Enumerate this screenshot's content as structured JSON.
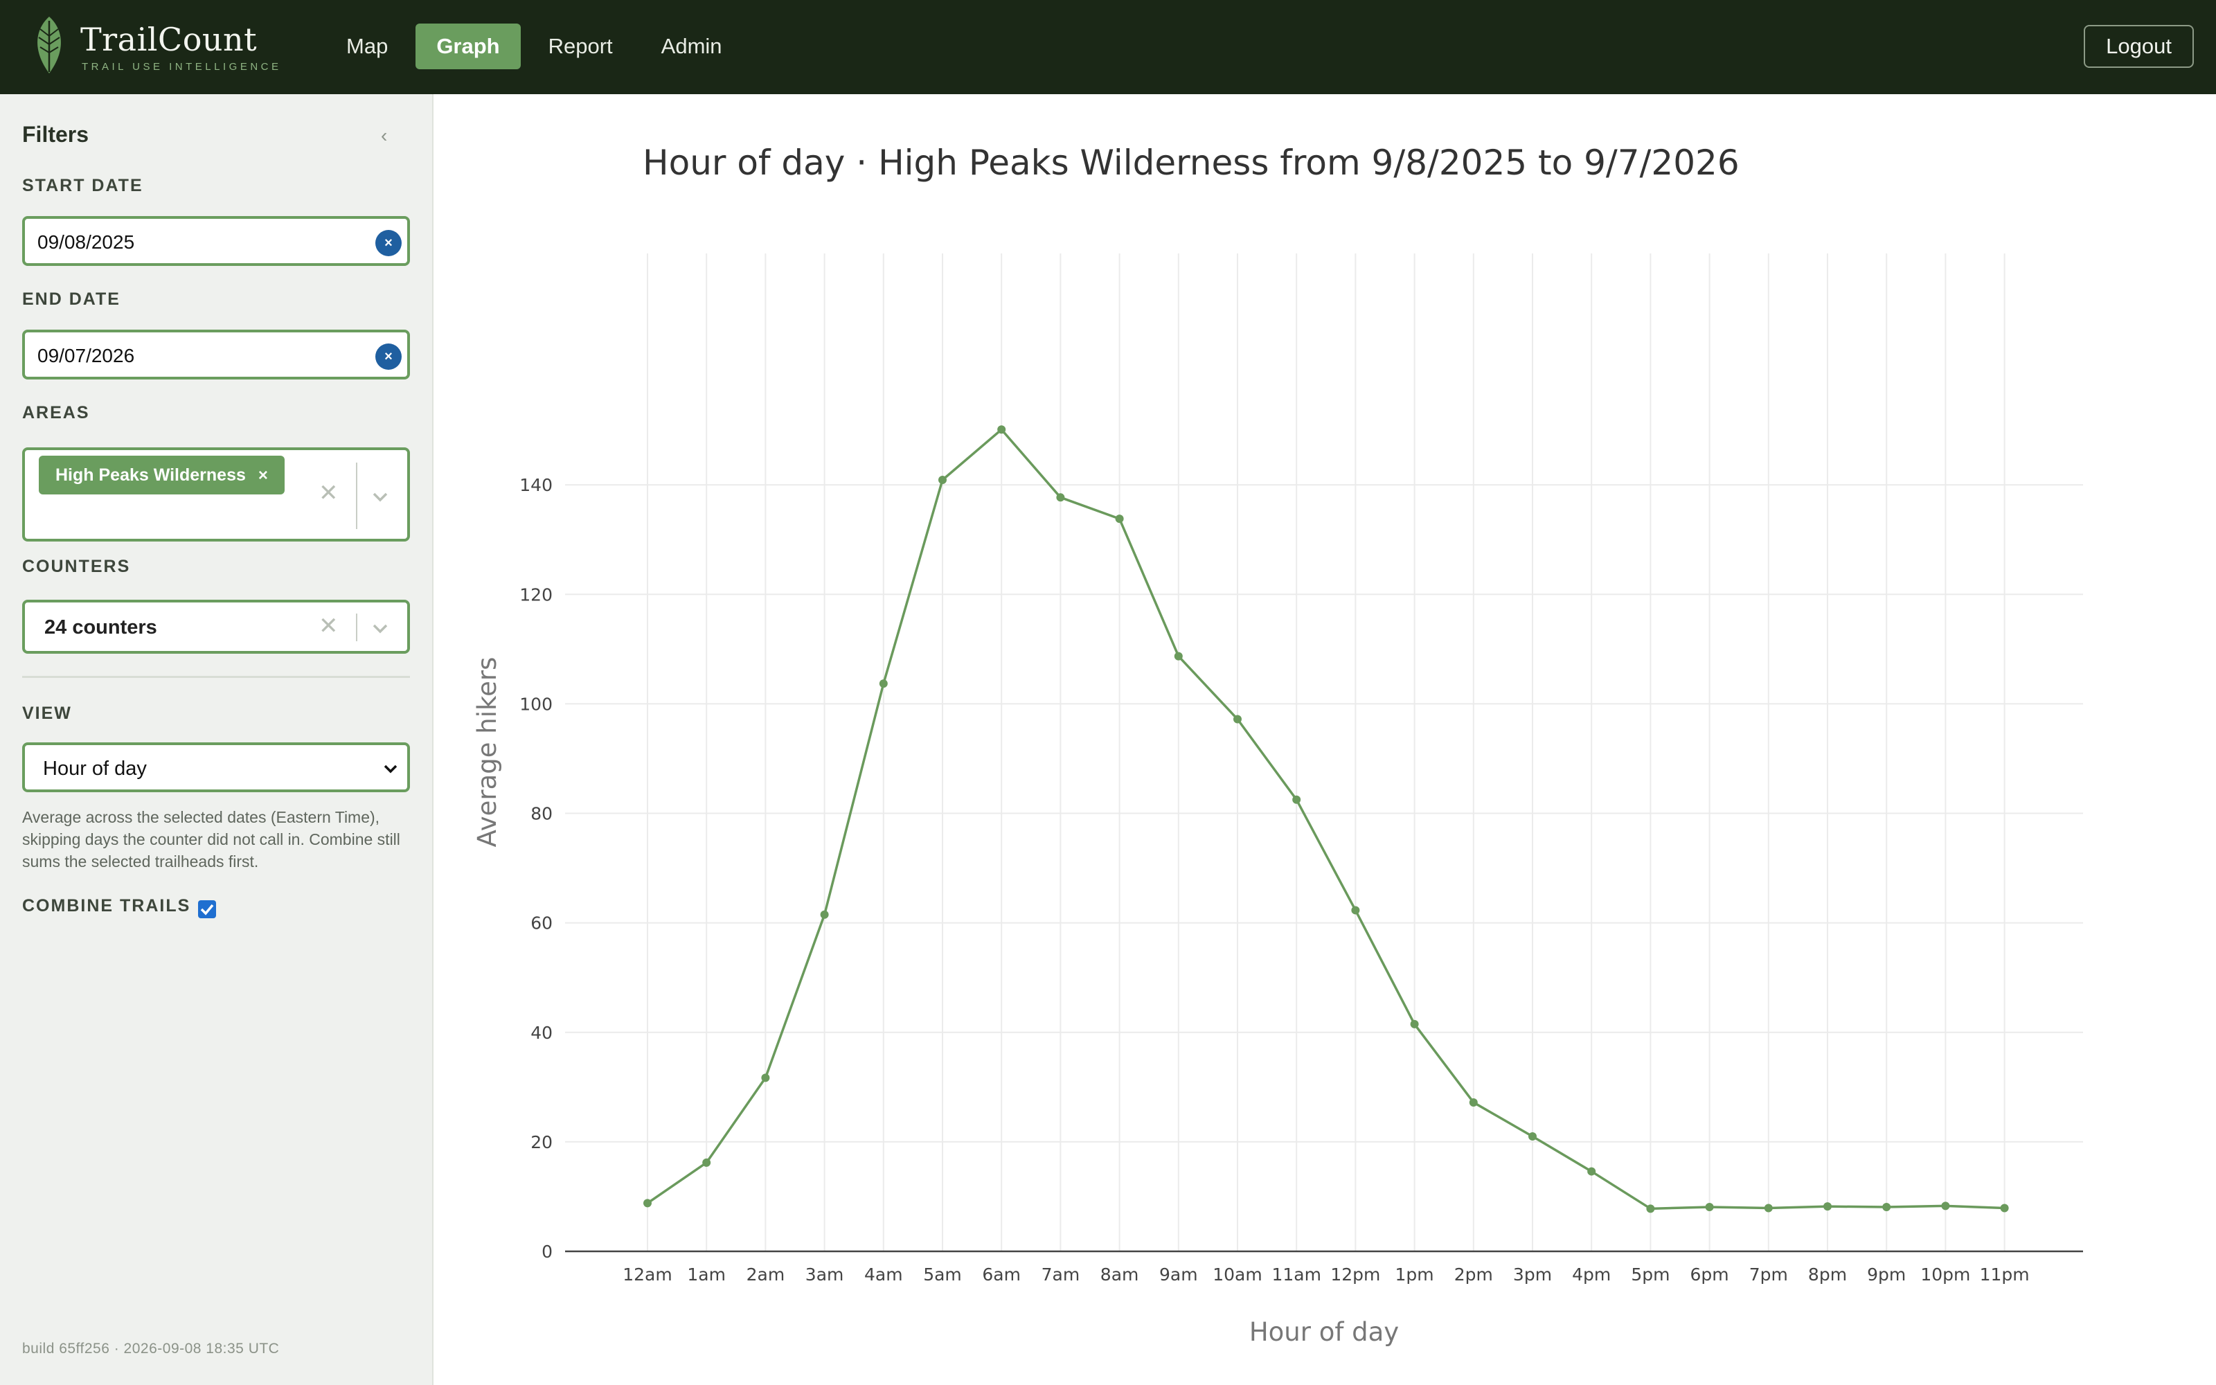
{
  "brand": {
    "name": "TrailCount",
    "tagline": "TRAIL USE INTELLIGENCE"
  },
  "nav": [
    {
      "label": "Map",
      "active": false
    },
    {
      "label": "Graph",
      "active": true
    },
    {
      "label": "Report",
      "active": false
    },
    {
      "label": "Admin",
      "active": false
    }
  ],
  "logout_label": "Logout",
  "filters": {
    "title": "Filters",
    "collapse_glyph": "‹",
    "start_date": {
      "label": "START DATE",
      "value": "09/08/2025",
      "clear_glyph": "×"
    },
    "end_date": {
      "label": "END DATE",
      "value": "09/07/2026",
      "clear_glyph": "×"
    },
    "areas": {
      "label": "AREAS",
      "chips": [
        "High Peaks Wilderness"
      ],
      "chip_remove_glyph": "×",
      "clear_glyph": "✕"
    },
    "counters": {
      "label": "COUNTERS",
      "value": "24 counters",
      "clear_glyph": "✕"
    },
    "view": {
      "label": "VIEW",
      "value": "Hour of day"
    },
    "hint": "Average across the selected dates (Eastern Time), skipping days the counter did not call in. Combine still sums the selected trailheads first.",
    "combine": {
      "label": "COMBINE TRAILS",
      "checked": true
    }
  },
  "build_info": "build 65ff256 · 2026-09-08 18:35 UTC",
  "colors": {
    "topbar": "#1a2716",
    "accent": "#6a9d5e",
    "line": "#6a9a5c",
    "clear": "#1f5fa0"
  },
  "chart_data": {
    "type": "line",
    "title": "Hour of day · High Peaks Wilderness from 9/8/2025 to 9/7/2026",
    "xlabel": "Hour of day",
    "ylabel": "Average hikers",
    "categories": [
      "12am",
      "1am",
      "2am",
      "3am",
      "4am",
      "5am",
      "6am",
      "7am",
      "8am",
      "9am",
      "10am",
      "11am",
      "12pm",
      "1pm",
      "2pm",
      "3pm",
      "4pm",
      "5pm",
      "6pm",
      "7pm",
      "8pm",
      "9pm",
      "10pm",
      "11pm"
    ],
    "values": [
      8.8,
      16.2,
      31.7,
      61.5,
      103.7,
      140.9,
      150.1,
      137.7,
      133.8,
      108.7,
      97.2,
      82.5,
      62.3,
      41.5,
      27.2,
      21.0,
      14.6,
      7.8,
      8.1,
      7.9,
      8.2,
      8.1,
      8.3,
      7.9
    ],
    "ylim": [
      0,
      160
    ],
    "yticks": [
      0,
      20,
      40,
      60,
      80,
      100,
      120,
      140
    ],
    "grid": true
  }
}
